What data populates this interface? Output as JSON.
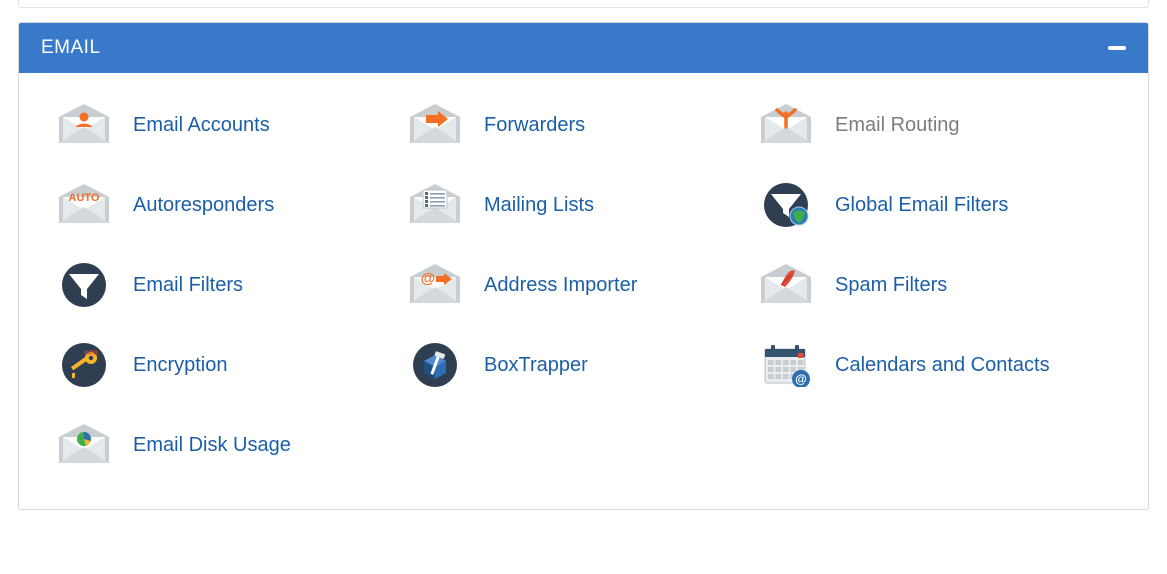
{
  "panel": {
    "title": "EMAIL"
  },
  "items": [
    {
      "label": "Email Accounts",
      "icon": "email-accounts",
      "muted": false
    },
    {
      "label": "Forwarders",
      "icon": "forwarders",
      "muted": false
    },
    {
      "label": "Email Routing",
      "icon": "email-routing",
      "muted": true
    },
    {
      "label": "Autoresponders",
      "icon": "autoresponders",
      "muted": false
    },
    {
      "label": "Mailing Lists",
      "icon": "mailing-lists",
      "muted": false
    },
    {
      "label": "Global Email Filters",
      "icon": "global-filters",
      "muted": false
    },
    {
      "label": "Email Filters",
      "icon": "email-filters",
      "muted": false
    },
    {
      "label": "Address Importer",
      "icon": "address-importer",
      "muted": false
    },
    {
      "label": "Spam Filters",
      "icon": "spam-filters",
      "muted": false
    },
    {
      "label": "Encryption",
      "icon": "encryption",
      "muted": false
    },
    {
      "label": "BoxTrapper",
      "icon": "boxtrapper",
      "muted": false
    },
    {
      "label": "Calendars and Contacts",
      "icon": "calendars",
      "muted": false
    },
    {
      "label": "Email Disk Usage",
      "icon": "disk-usage",
      "muted": false
    }
  ]
}
